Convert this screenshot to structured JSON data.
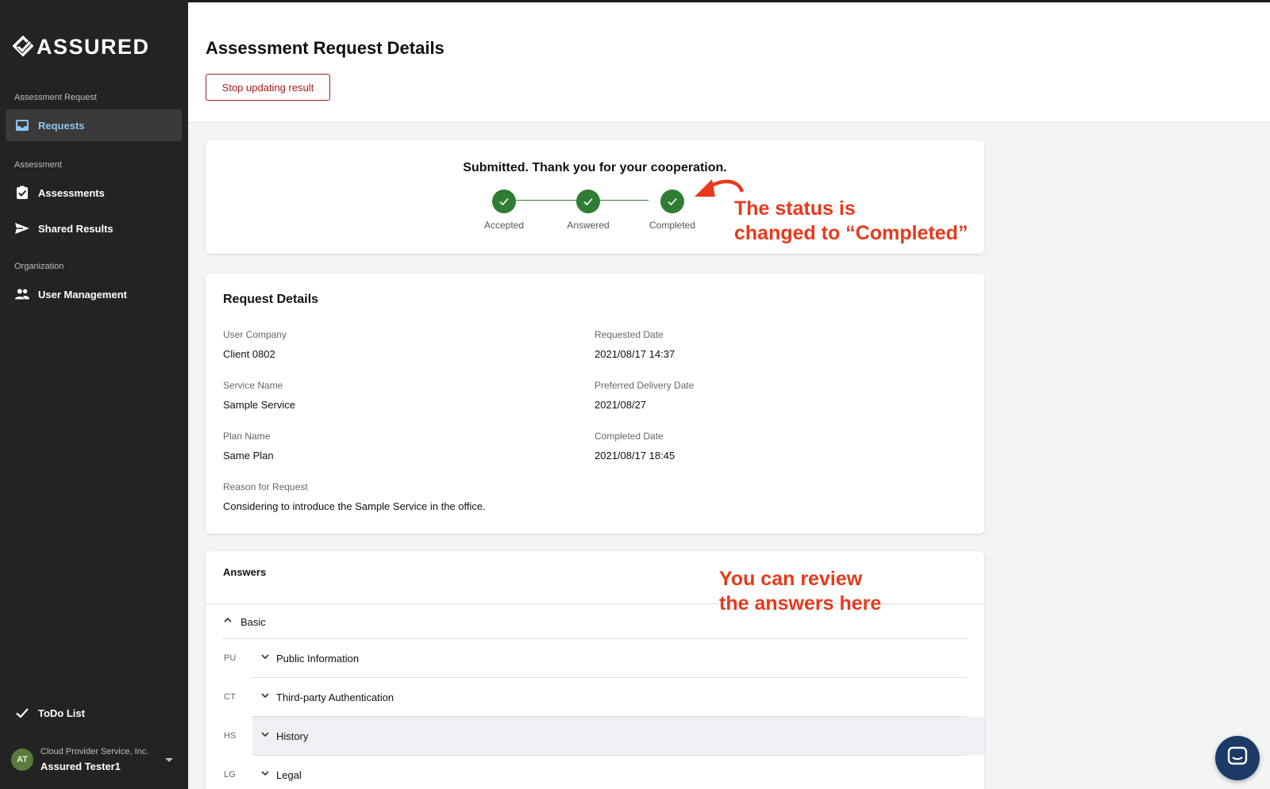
{
  "app": {
    "logo_text": "ASSURED"
  },
  "sidebar": {
    "sections": [
      {
        "label": "Assessment Request"
      },
      {
        "label": "Assessment"
      },
      {
        "label": "Organization"
      }
    ],
    "items": [
      {
        "label": "Requests",
        "icon": "inbox-icon",
        "active": true
      },
      {
        "label": "Assessments",
        "icon": "clipboard-check-icon",
        "active": false
      },
      {
        "label": "Shared Results",
        "icon": "send-icon",
        "active": false
      },
      {
        "label": "User Management",
        "icon": "people-icon",
        "active": false
      },
      {
        "label": "ToDo List",
        "icon": "check-icon",
        "active": false
      }
    ],
    "account": {
      "initials": "AT",
      "company": "Cloud Provider Service, Inc.",
      "user": "Assured Tester1"
    }
  },
  "header": {
    "title": "Assessment Request Details",
    "stop_button": "Stop updating result"
  },
  "status": {
    "message": "Submitted. Thank you for your cooperation.",
    "steps": [
      {
        "label": "Accepted",
        "done": true
      },
      {
        "label": "Answered",
        "done": true
      },
      {
        "label": "Completed",
        "done": true
      }
    ]
  },
  "details": {
    "title": "Request Details",
    "fields": [
      {
        "label": "User Company",
        "value": "Client 0802"
      },
      {
        "label": "Requested Date",
        "value": "2021/08/17 14:37"
      },
      {
        "label": "Service Name",
        "value": "Sample Service"
      },
      {
        "label": "Preferred Delivery Date",
        "value": "2021/08/27"
      },
      {
        "label": "Plan Name",
        "value": "Same Plan"
      },
      {
        "label": "Completed Date",
        "value": "2021/08/17 18:45"
      },
      {
        "label": "Reason for Request",
        "value": "Considering to introduce the Sample Service in the office."
      }
    ]
  },
  "answers": {
    "title": "Answers",
    "group": "Basic",
    "rows": [
      {
        "code": "PU",
        "label": "Public Information"
      },
      {
        "code": "CT",
        "label": "Third-party Authentication"
      },
      {
        "code": "HS",
        "label": "History"
      },
      {
        "code": "LG",
        "label": "Legal"
      }
    ]
  },
  "annotations": {
    "status_line1": "The status is",
    "status_line2": "changed to “Completed”",
    "answers_line1": "You can review",
    "answers_line2": "the answers here"
  },
  "colors": {
    "sidebar_bg": "#232323",
    "active_text": "#8ec5ef",
    "success": "#2f7d32",
    "danger": "#a31c1c",
    "annotation": "#e8391c",
    "chat_button": "#1b3a66"
  }
}
